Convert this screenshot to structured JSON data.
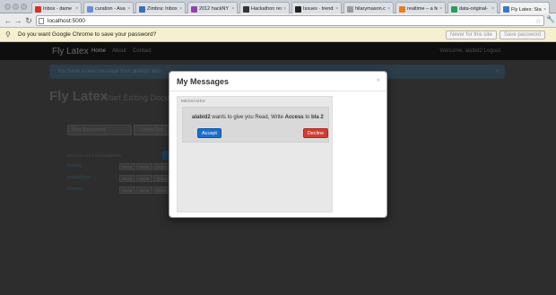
{
  "browser": {
    "tabs": [
      {
        "title": "Inbox - dame",
        "favicon_color": "#d93025"
      },
      {
        "title": "curation - Asa",
        "favicon_color": "#6b8fd6"
      },
      {
        "title": "Zimbra: Inbox",
        "favicon_color": "#3b6fb5"
      },
      {
        "title": "2012 hackNY S",
        "favicon_color": "#8e44ad"
      },
      {
        "title": "Hackathon res",
        "favicon_color": "#333333"
      },
      {
        "title": "Issues · trends",
        "favicon_color": "#222222"
      },
      {
        "title": "hilarymason.co",
        "favicon_color": "#999999"
      },
      {
        "title": "realtime – a fe",
        "favicon_color": "#e67e22"
      },
      {
        "title": "data-original-",
        "favicon_color": "#2a9d5c"
      },
      {
        "title": "Fly Latex: Star",
        "favicon_color": "#3b78c4"
      }
    ],
    "active_tab_index": 9,
    "url": "localhost:5000",
    "infobar": {
      "message": "Do you want Google Chrome to save your password?",
      "never_label": "Never for this site",
      "save_label": "Save password"
    }
  },
  "app": {
    "brand": "Fly Latex",
    "nav": [
      "Home",
      "About",
      "Contact"
    ],
    "welcome": "Welcome, alabid2 Logout",
    "alert": "You have a new message from alabid2 abo",
    "title": "Fly Latex",
    "subtitle": "Start Editing Documents",
    "new_doc_placeholder": "New Document",
    "create_label": "Create Doc",
    "docs_heading": "MY FLYLATEX DOCUMENTS",
    "documents": [
      {
        "name": "testing",
        "perms": [
          "Read",
          "Write",
          "Share"
        ]
      },
      {
        "name": "asdasfdsa",
        "perms": [
          "Read",
          "Write",
          "Share"
        ]
      },
      {
        "name": "firstdoc",
        "perms": [
          "Read",
          "Write",
          "Share"
        ]
      }
    ]
  },
  "modal": {
    "title": "My Messages",
    "close": "×",
    "section_label": "MESSAGES",
    "message": {
      "sender": "alabid2",
      "text_1": "wants to give you Read, Write",
      "access": "Access",
      "text_2": "to",
      "doc": "bla 2"
    },
    "accept_label": "Accept",
    "decline_label": "Decline"
  },
  "colors": {
    "accept": "#1a6fcc",
    "decline": "#d23d33",
    "backdrop": "#2d2d2d"
  }
}
